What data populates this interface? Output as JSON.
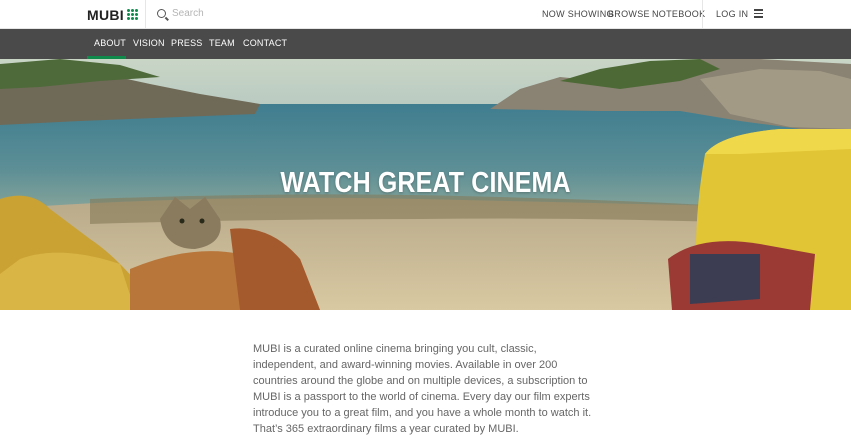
{
  "logo": {
    "text": "MUBI"
  },
  "search": {
    "placeholder": "Search"
  },
  "header": {
    "nav": [
      {
        "label": "NOW SHOWING"
      },
      {
        "label": "BROWSE"
      },
      {
        "label": "NOTEBOOK"
      }
    ],
    "login_label": "LOG IN"
  },
  "subnav": {
    "items": [
      {
        "label": "ABOUT"
      },
      {
        "label": "VISION"
      },
      {
        "label": "PRESS"
      },
      {
        "label": "TEAM"
      },
      {
        "label": "CONTACT"
      }
    ],
    "active": "ABOUT"
  },
  "hero": {
    "title": "WATCH GREAT CINEMA"
  },
  "intro": {
    "text": "MUBI is a curated online cinema bringing you cult, classic, independent, and award-winning movies. Available in over 200 countries around the globe and on multiple devices, a subscription to MUBI is a passport to the world of cinema. Every day our film experts introduce you to a great film, and you have a whole month to watch it. That’s 365 extraordinary films a year curated by MUBI."
  },
  "colors": {
    "accent": "#0f8a4b",
    "subnav_bg": "#4a4a4a"
  },
  "icons": [
    "logo-dots-icon",
    "search-icon",
    "menu-icon"
  ]
}
